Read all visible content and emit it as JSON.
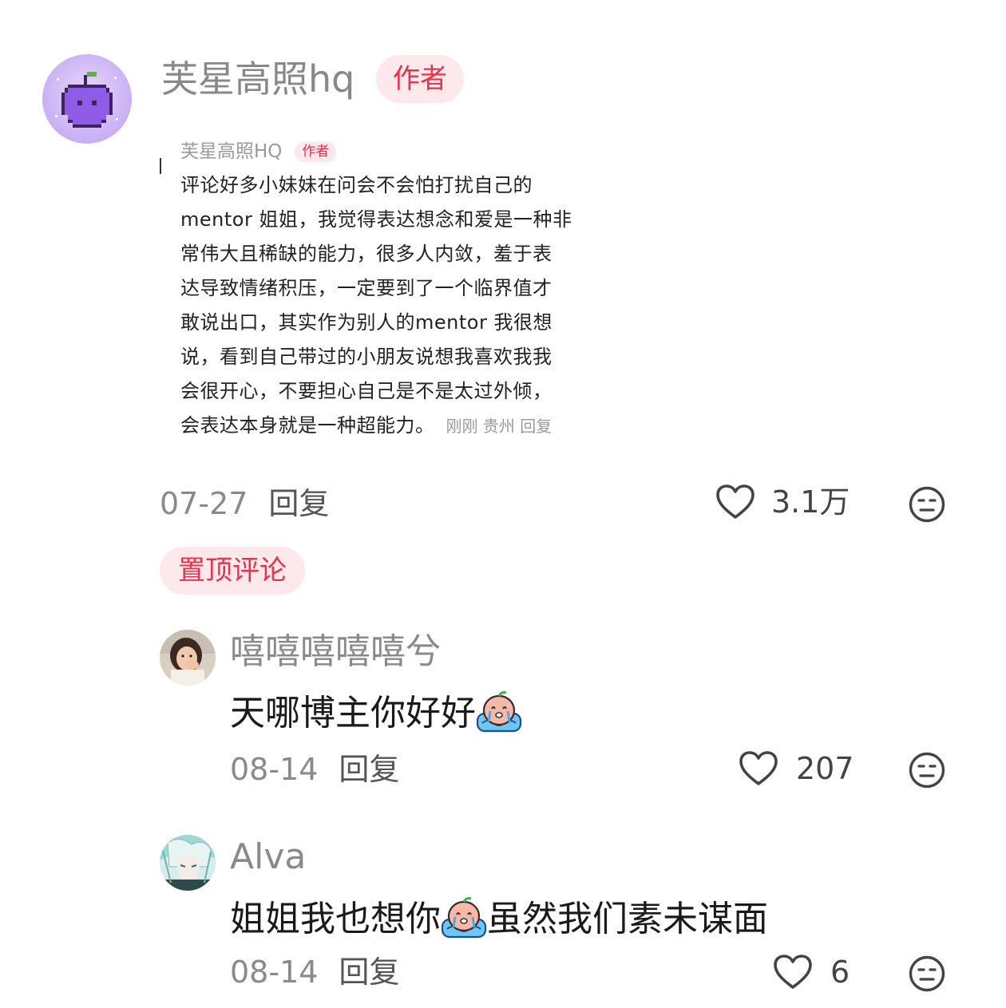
{
  "main_comment": {
    "username": "芙星高照hq",
    "author_badge": "作者",
    "date": "07-27",
    "reply_label": "回复",
    "like_count": "3.1万",
    "pinned_label": "置顶评论",
    "embedded_screenshot": {
      "username": "芙星高照HQ",
      "author_badge": "作者",
      "lines": [
        "评论好多小妹妹在问会不会怕打扰自己的",
        "mentor 姐姐，我觉得表达想念和爱是一种非",
        "常伟大且稀缺的能力，很多人内敛，羞于表",
        "达导致情绪积压，一定要到了一个临界值才",
        "敢说出口，其实作为别人的mentor 我很想",
        "说，看到自己带过的小朋友说想我喜欢我我",
        "会很开心，不要担心自己是不是太过外倾，",
        "会表达本身就是一种超能力。"
      ],
      "meta": "刚刚 贵州 回复"
    }
  },
  "replies": [
    {
      "username": "嘻嘻嘻嘻嘻兮",
      "text": "天哪博主你好好",
      "date": "08-14",
      "reply_label": "回复",
      "like_count": "207"
    },
    {
      "username": "Alva",
      "text_before": "姐姐我也想你",
      "text_after": "虽然我们素未谋面",
      "date": "08-14",
      "reply_label": "回复",
      "like_count": "6"
    }
  ],
  "colors": {
    "accent": "#e8334d",
    "badge_bg": "#fde8ec",
    "muted": "#8a8a8a"
  },
  "icons": [
    "pixel-apple-avatar",
    "heart-outline-icon",
    "meh-face-icon",
    "crying-face-emoji"
  ]
}
